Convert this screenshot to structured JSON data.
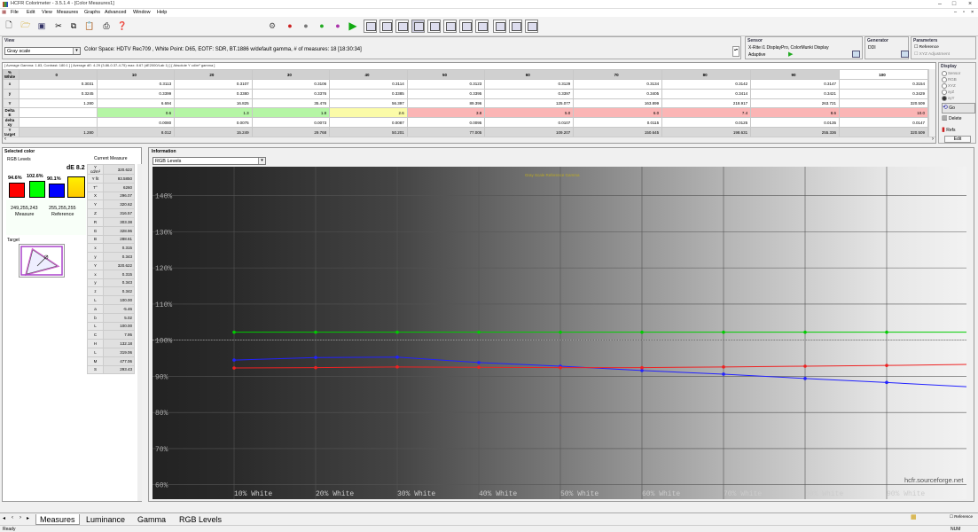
{
  "window": {
    "title": "HCFR Colorimeter - 3.5.1.4 - [Color Measures1]"
  },
  "menu": [
    "File",
    "Edit",
    "View",
    "Measures",
    "Graphs",
    "Advanced",
    "Window",
    "Help"
  ],
  "view": {
    "label": "View",
    "dropdown": "Gray scale",
    "info": "Color Space: HDTV Rec709 , White Point: D65, EOTF:  SDR, BT.1886 w/default gamma, # of measures: 18 [18:30:34]"
  },
  "sensor": {
    "label": "Sensor",
    "line1": "X-Rite i1 DisplayPro, ColorMunki Display",
    "line2": "Adaptive"
  },
  "generator": {
    "label": "Generator",
    "value": "DDI"
  },
  "parameters": {
    "label": "Parameters",
    "reference": "Reference",
    "xyz_adj": "XYZ Adjustment"
  },
  "display_group": {
    "label": "Display",
    "options": [
      "Sensor",
      "RGB",
      "XYZ",
      "xyZ",
      "xyY"
    ],
    "go": "Go",
    "delete": "Delete",
    "refs": "Refs",
    "edit": "Edit"
  },
  "table": {
    "summary": "[ Average Gamma: 1.83, Contrast: 180:1 ] [ Average dE: 4.29 (3.86-0.37-4.75) max: 8.67 (dE2000/Lab 1) ] [ Absolute Y cd/m² gamma ]",
    "corner": "% White",
    "headers": [
      "0",
      "10",
      "20",
      "30",
      "40",
      "50",
      "60",
      "70",
      "80",
      "90",
      "100"
    ],
    "rows": [
      {
        "label": "x",
        "cells": [
          "0.3031",
          "0.3113",
          "0.3107",
          "0.3106",
          "0.3114",
          "0.3123",
          "0.3129",
          "0.3134",
          "0.3142",
          "0.3147",
          "0.3154"
        ]
      },
      {
        "label": "y",
        "cells": [
          "0.3245",
          "0.3399",
          "0.3380",
          "0.3376",
          "0.3385",
          "0.3395",
          "0.3397",
          "0.3405",
          "0.3414",
          "0.3421",
          "0.3429"
        ]
      },
      {
        "label": "Y",
        "cells": [
          "1.280",
          "6.694",
          "16.825",
          "35.476",
          "56.397",
          "89.396",
          "125.077",
          "163.899",
          "218.917",
          "263.721",
          "320.509"
        ]
      },
      {
        "label": "Delta E",
        "cells": [
          "",
          "0.6",
          "1.3",
          "1.8",
          "2.6",
          "3.8",
          "5.0",
          "6.0",
          "7.4",
          "8.6",
          "10.0"
        ]
      },
      {
        "label": "delta xy",
        "cells": [
          "",
          "0.0080",
          "0.0075",
          "0.0073",
          "0.0087",
          "0.0095",
          "0.0107",
          "0.0115",
          "0.0125",
          "0.0135",
          "0.0147"
        ]
      },
      {
        "label": "Y target",
        "cells": [
          "1.280",
          "8.012",
          "15.249",
          "29.768",
          "50.201",
          "77.005",
          "109.207",
          "150.645",
          "198.631",
          "255.336",
          "320.509"
        ]
      }
    ]
  },
  "selected_color": {
    "label": "Selected color",
    "rgb_levels": "RGB Levels",
    "de": "dE 8.2",
    "bars": [
      {
        "label": "94.6%",
        "pct": 94.6,
        "color": "#ff0000"
      },
      {
        "label": "102.6%",
        "pct": 102.6,
        "color": "#00ff00"
      },
      {
        "label": "90.1%",
        "pct": 90.1,
        "color": "#0000ff"
      }
    ],
    "measure_rgb": "249,255,243",
    "measure_label": "Measure",
    "ref_rgb": "255,255,255",
    "ref_label": "Reference",
    "target": "Target"
  },
  "current_measure": {
    "label": "Current Measure",
    "rows": [
      [
        "Y cd/m²",
        "320.622"
      ],
      [
        "Y fit",
        "93.5850"
      ],
      [
        "T°",
        "6260"
      ],
      [
        "X",
        "296.07"
      ],
      [
        "Y",
        "320.62"
      ],
      [
        "Z",
        "316.57"
      ],
      [
        "R",
        "303.38"
      ],
      [
        "G",
        "328.96"
      ],
      [
        "B",
        "288.61"
      ],
      [
        "x",
        "0.315"
      ],
      [
        "y",
        "0.343"
      ],
      [
        "Y",
        "320.622"
      ],
      [
        "x",
        "0.315"
      ],
      [
        "y",
        "0.343"
      ],
      [
        "z",
        "0.342"
      ],
      [
        "L",
        "100.00"
      ],
      [
        "a",
        "-5.46"
      ],
      [
        "b",
        "5.02"
      ],
      [
        "L",
        "100.00"
      ],
      [
        "C",
        "7.95"
      ],
      [
        "H",
        "132.18"
      ],
      [
        "L",
        "319.06"
      ],
      [
        "M",
        "477.06"
      ],
      [
        "S",
        "293.43"
      ]
    ]
  },
  "information": {
    "label": "Information",
    "dropdown": "RGB Levels"
  },
  "chart_data": {
    "type": "line",
    "title": "Gray Scale Reference Gamma",
    "x_ticks": [
      "10% White",
      "20% White",
      "30% White",
      "40% White",
      "50% White",
      "60% White",
      "70% White",
      "80% White",
      "90% White"
    ],
    "y_ticks": [
      "140%",
      "130%",
      "120%",
      "110%",
      "100%",
      "90%",
      "80%",
      "70%",
      "60%"
    ],
    "ylim": [
      56,
      148
    ],
    "x": [
      10,
      20,
      30,
      40,
      50,
      60,
      70,
      80,
      90,
      100
    ],
    "series": [
      {
        "color": "#00cc00",
        "values": [
          102.2,
          102.2,
          102.2,
          102.2,
          102.2,
          102.2,
          102.2,
          102.2,
          102.2,
          102.2
        ]
      },
      {
        "color": "#2222ff",
        "values": [
          94.5,
          95.2,
          95.3,
          93.8,
          92.8,
          91.6,
          90.6,
          89.4,
          88.3,
          87.1
        ]
      },
      {
        "color": "#ee2222",
        "values": [
          92.3,
          92.4,
          92.6,
          92.5,
          92.4,
          92.4,
          92.6,
          92.8,
          93.0,
          93.3
        ]
      }
    ],
    "watermark": "hcfr.sourceforge.net",
    "ref_line": 100
  },
  "tabs": [
    "Measures",
    "Luminance",
    "Gamma",
    "RGB Levels"
  ],
  "status": {
    "left": "Ready",
    "right": "NUM",
    "reference": "Reference"
  }
}
